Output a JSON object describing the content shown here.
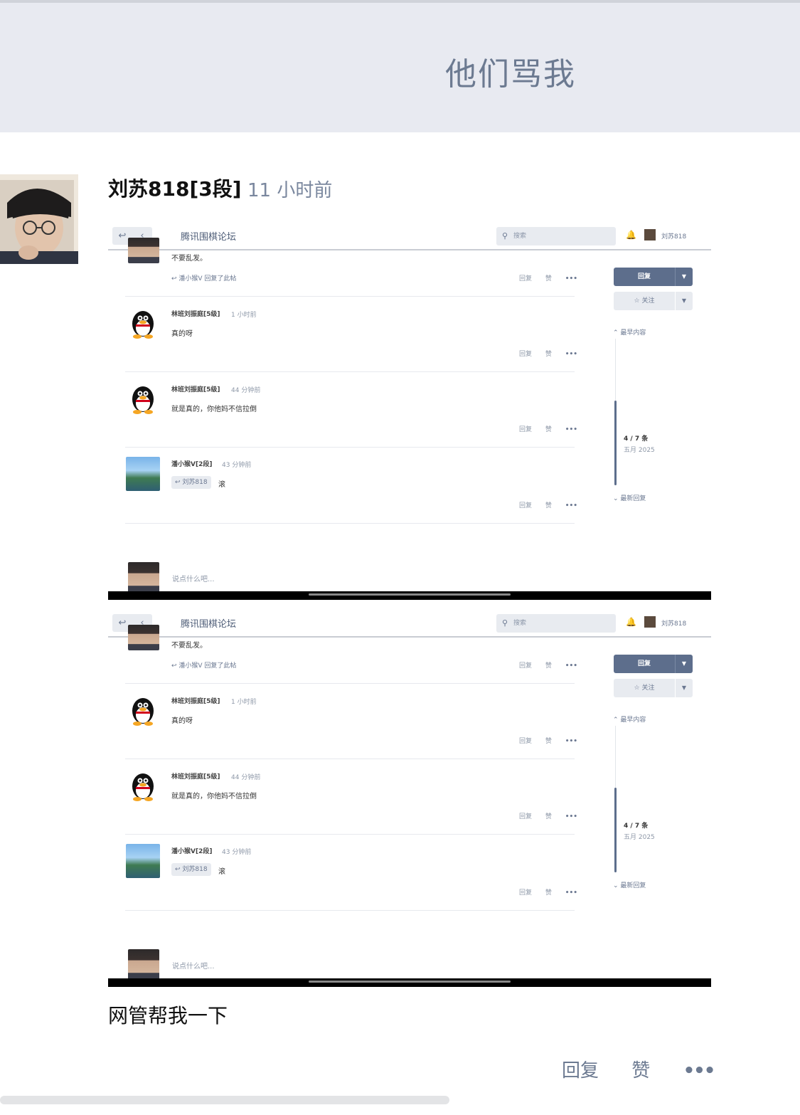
{
  "page": {
    "title": "他们骂我"
  },
  "post": {
    "author": "刘苏818[3段]",
    "time": "11 小时前",
    "text": "网管帮我一下",
    "actions": {
      "reply": "回复",
      "like": "赞",
      "more": "•••"
    }
  },
  "screenshot": {
    "nav": {
      "back_icon": "↩",
      "prev_icon": "‹"
    },
    "forum_title": "腾讯围棋论坛",
    "search_placeholder": "搜索",
    "user_name": "刘苏818",
    "posts": [
      {
        "content": "不要乱发。",
        "replied_note": "潘小猴V 回复了此帖",
        "actions": [
          "回复",
          "赞",
          "•••"
        ]
      },
      {
        "author": "林班刘振庭[5级]",
        "time": "1 小时前",
        "content": "真的呀",
        "actions": [
          "回复",
          "赞",
          "•••"
        ]
      },
      {
        "author": "林班刘振庭[5级]",
        "time": "44 分钟前",
        "content": "就是真的，你他妈不信拉倒",
        "actions": [
          "回复",
          "赞",
          "•••"
        ]
      },
      {
        "author": "潘小猴V[2段]",
        "time": "43 分钟前",
        "reply_tag": "刘苏818",
        "content": "滚",
        "actions": [
          "回复",
          "赞",
          "•••"
        ]
      }
    ],
    "sidebar": {
      "reply_button": "回复",
      "follow_button": "关注",
      "earliest": "最早内容",
      "latest": "最新回复",
      "progress": "4 / 7 条",
      "progress_date": "五月 2025"
    },
    "compose_placeholder": "说点什么吧..."
  },
  "colors": {
    "accent": "#5d6e8c",
    "header_bg": "#e8eaf1",
    "muted": "#6c7a91"
  }
}
